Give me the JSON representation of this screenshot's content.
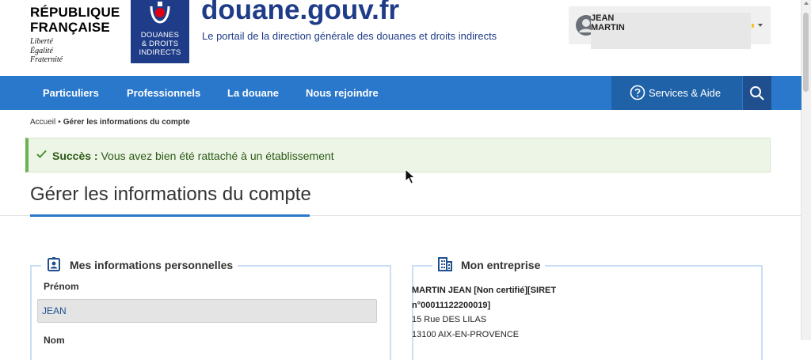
{
  "header": {
    "republic_title": "RÉPUBLIQUE FRANÇAISE",
    "motto": [
      "Liberté",
      "Égalité",
      "Fraternité"
    ],
    "agency_logo_lines": [
      "DOUANES",
      "& DROITS",
      "INDIRECTS"
    ],
    "site_title": "douane.gouv.fr",
    "site_subtitle": "Le portail de la direction générale des douanes et droits indirects",
    "user": {
      "first_name": "JEAN",
      "last_name": "MARTIN"
    }
  },
  "nav": {
    "items": [
      "Particuliers",
      "Professionnels",
      "La douane",
      "Nous rejoindre"
    ],
    "services_label": "Services & Aide",
    "search_icon": "search-icon"
  },
  "breadcrumb": {
    "home": "Accueil",
    "separator": "•",
    "current": "Gérer les informations du compte"
  },
  "alert": {
    "title": "Succès :",
    "message": "Vous avez bien été rattaché à un établissement"
  },
  "page": {
    "title": "Gérer les informations du compte"
  },
  "personal": {
    "legend": "Mes informations personnelles",
    "first_name_label": "Prénom",
    "first_name_value": "JEAN",
    "last_name_label": "Nom"
  },
  "company": {
    "legend": "Mon entreprise",
    "name": "MARTIN JEAN [Non certifié][SIRET n°00011122200019]",
    "address_line1": "15 Rue DES LILAS",
    "address_line2": "13100 AIX-EN-PROVENCE"
  },
  "colors": {
    "brand_blue": "#1f3c88",
    "nav_blue": "#2a78cc",
    "success_green": "#6bb252"
  }
}
